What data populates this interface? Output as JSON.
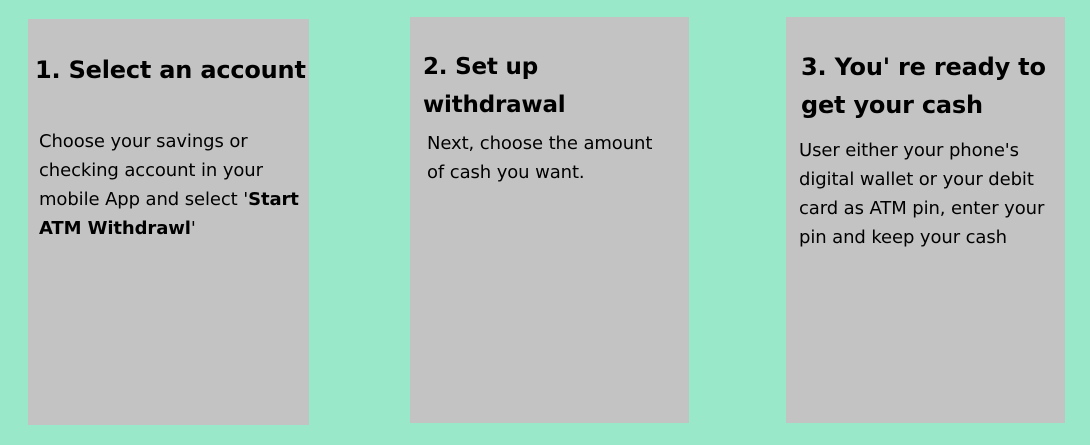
{
  "steps": [
    {
      "title": "1. Select an account",
      "body_prefix": "Choose your savings or checking account in your mobile App and select '",
      "body_emphasis": "Start ATM Withdrawl",
      "body_suffix": "'"
    },
    {
      "title": "2. Set up withdrawal",
      "body": "Next, choose the amount of cash you want."
    },
    {
      "title": "3. You' re ready to get your cash",
      "body": "User either your phone's digital wallet or your debit card as ATM pin, enter your pin and keep your cash"
    }
  ],
  "colors": {
    "background": "#98e8c9",
    "card": "#c3c3c3",
    "text": "#000000"
  }
}
